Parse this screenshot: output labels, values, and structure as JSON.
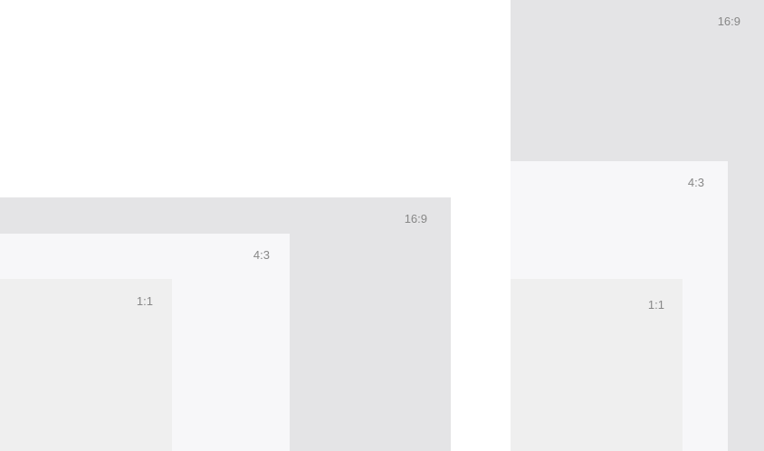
{
  "colors": {
    "background": "#ffffff",
    "ratio_16_9": "#e4e4e6",
    "ratio_4_3": "#f7f7f9",
    "ratio_1_1": "#efefef",
    "label": "#878787"
  },
  "left_group": {
    "frames": [
      {
        "label": "16:9"
      },
      {
        "label": "4:3"
      },
      {
        "label": "1:1"
      }
    ]
  },
  "right_group": {
    "frames": [
      {
        "label": "16:9"
      },
      {
        "label": "4:3"
      },
      {
        "label": "1:1"
      }
    ]
  }
}
